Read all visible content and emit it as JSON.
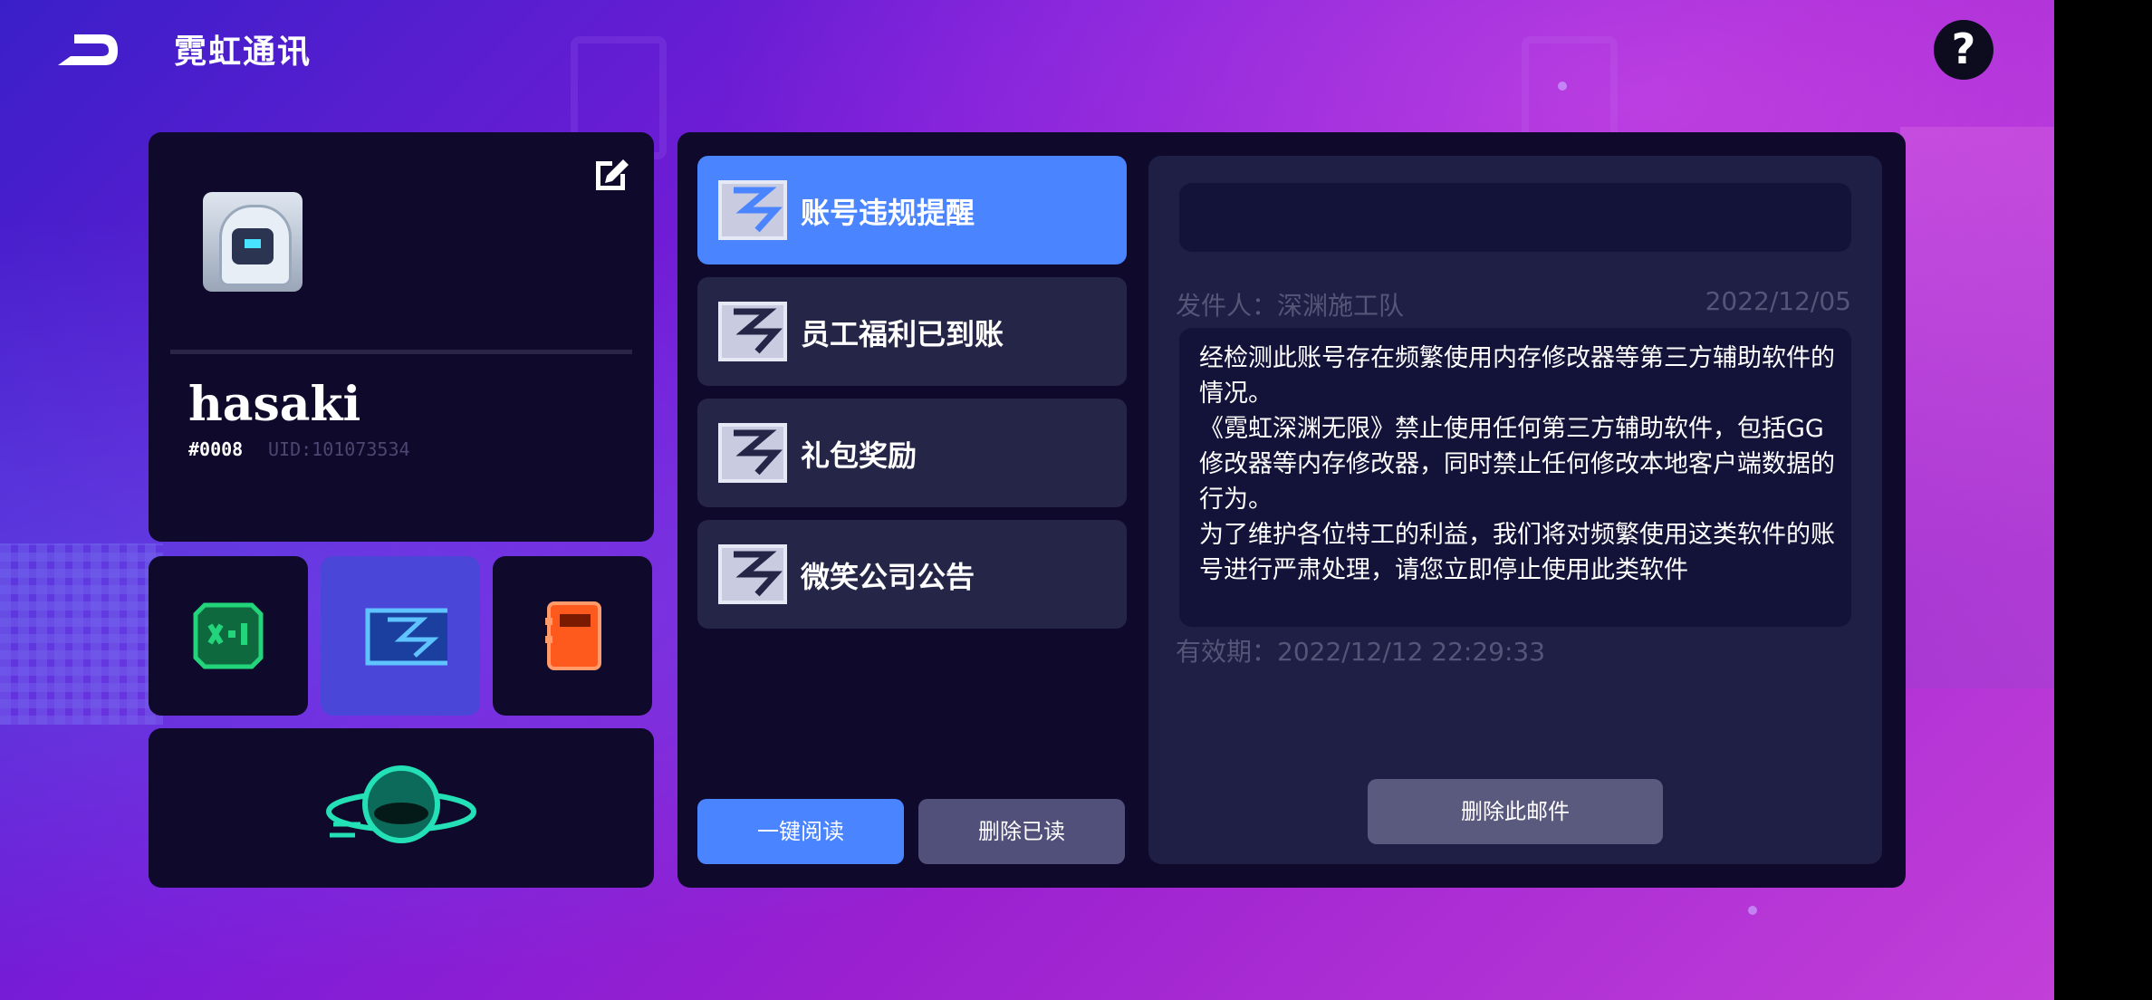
{
  "header": {
    "title": "霓虹通讯"
  },
  "profile": {
    "username": "hasaki",
    "tag": "#0008",
    "uid": "UID:101073534"
  },
  "mail": {
    "items": [
      {
        "label": "账号违规提醒"
      },
      {
        "label": "员工福利已到账"
      },
      {
        "label": "礼包奖励"
      },
      {
        "label": "微笑公司公告"
      }
    ],
    "read_all_label": "一键阅读",
    "delete_read_label": "删除已读"
  },
  "detail": {
    "sender": "发件人：深渊施工队",
    "date": "2022/12/05",
    "body": "经检测此账号存在频繁使用内存修改器等第三方辅助软件的情况。\n《霓虹深渊无限》禁止使用任何第三方辅助软件，包括GG修改器等内存修改器，同时禁止任何修改本地客户端数据的行为。\n为了维护各位特工的利益，我们将对频繁使用这类软件的账号进行严肃处理，请您立即停止使用此类软件",
    "expiry": "有效期：2022/12/12 22:29:33",
    "delete_label": "删除此邮件"
  },
  "colors": {
    "accent": "#4a84ff",
    "panel": "#0f0a2c",
    "friends_icon": "#22d47a",
    "notes_icon": "#ff5a1e",
    "planet_icon": "#23e0b6"
  },
  "icons": [
    "back-icon",
    "help-icon",
    "edit-icon",
    "friends-icon",
    "mail-icon",
    "notes-icon",
    "planet-icon",
    "envelope-icon"
  ]
}
